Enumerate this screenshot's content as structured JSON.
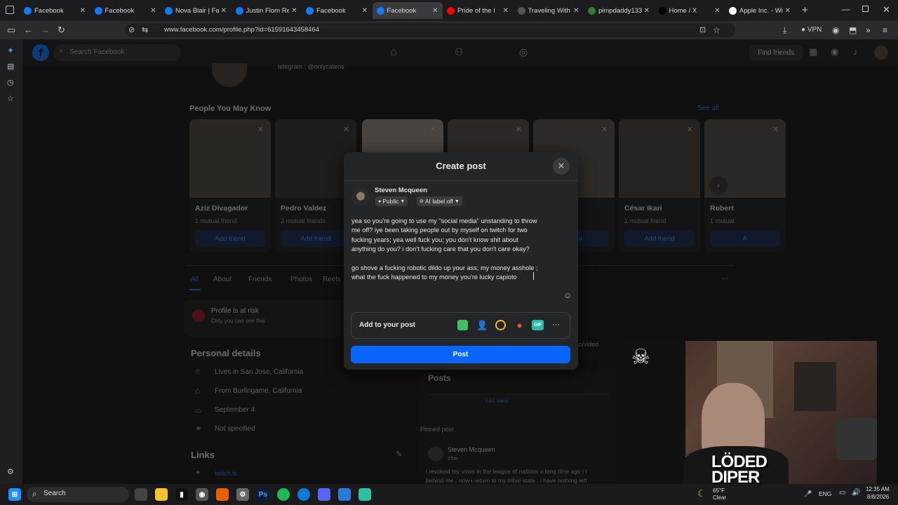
{
  "browser": {
    "tabs": [
      {
        "title": "Facebook",
        "icon": "facebook-icon",
        "color": "#1877f2"
      },
      {
        "title": "Facebook",
        "icon": "facebook-icon",
        "color": "#1877f2"
      },
      {
        "title": "Nova Blair | Faceb",
        "icon": "facebook-icon",
        "color": "#1877f2"
      },
      {
        "title": "Justin Flom Reels",
        "icon": "facebook-icon",
        "color": "#1877f2"
      },
      {
        "title": "Facebook",
        "icon": "facebook-icon",
        "color": "#1877f2"
      },
      {
        "title": "Facebook",
        "icon": "facebook-icon",
        "color": "#1877f2"
      },
      {
        "title": "Pride of the I",
        "icon": "youtube-icon",
        "color": "#ff0000"
      },
      {
        "title": "Traveling With A",
        "icon": "shield-icon",
        "color": "#555555"
      },
      {
        "title": "pimpdaddy1337",
        "icon": "leaf-icon",
        "color": "#2e7d32"
      },
      {
        "title": "Home / X",
        "icon": "x-icon",
        "color": "#000000"
      },
      {
        "title": "Apple Inc. - Wikip",
        "icon": "wikipedia-icon",
        "color": "#ffffff"
      }
    ],
    "url": "www.facebook.com/profile.php?id=61591643458464",
    "vpn_label": "VPN"
  },
  "facebook": {
    "search_placeholder": "Search Facebook",
    "find_friends": "Find friends",
    "profile_handle": "telegram : @onlycateos",
    "pymk_title": "People You May Know",
    "see_all": "See all",
    "suggestions": [
      {
        "name": "Aziz Divagador",
        "mutual": "1 mutual friend",
        "button": "Add friend"
      },
      {
        "name": "Pedro Valdez",
        "mutual": "3 mutual friends",
        "button": "Add friend"
      },
      {
        "name": "",
        "mutual": "",
        "button": ""
      },
      {
        "name": "",
        "mutual": "",
        "button": ""
      },
      {
        "name": "oy",
        "mutual": "nds",
        "button": "friend"
      },
      {
        "name": "César Ikari",
        "mutual": "1 mutual friend",
        "button": "Add friend"
      },
      {
        "name": "Robert",
        "mutual": "1 mutual",
        "button": "A"
      }
    ],
    "profile_tabs": [
      "All",
      "About",
      "Friends",
      "Photos",
      "Reels"
    ],
    "risk_title": "Profile is at risk",
    "risk_sub": "Only you can see this",
    "personal_details_title": "Personal details",
    "details": [
      {
        "icon": "location-icon",
        "text": "Lives in San Jose, California"
      },
      {
        "icon": "home-icon",
        "text": "From Burlingame, California"
      },
      {
        "icon": "cake-icon",
        "text": "September 4"
      },
      {
        "icon": "relationship-icon",
        "text": "Not specified"
      }
    ],
    "links_title": "Links",
    "link_item": "twitch.tv",
    "photo_video": "to/video",
    "posts_title": "Posts",
    "list_view": "List view",
    "pinned_post": "Pinned post",
    "pinned_author": "Steven Mcqueen",
    "pinned_time": "15m",
    "pinned_text_1": "i revoked my vows in the league of nations a long time ago i t",
    "pinned_text_2": "behind me ; now i return to my tribal state ; i have nothing left"
  },
  "modal": {
    "title": "Create post",
    "author": "Steven Mcqueen",
    "audience": "Public",
    "ai_label": "AI label off",
    "lines": [
      "yea so you're going to use my \"social media\" unstanding to throw",
      "me off? iye been taking people out by myself on twitch for two",
      "fucking years; yea well fuck you; you don't know shit about",
      "anything do you? i don't fucking care that you don't care okay?",
      "",
      "go shove a fucking robotic dildo up your ass;  my money asshole ;",
      "what the fuck happened to my money you're lucky capioto"
    ],
    "add_to_post": "Add to your post",
    "post_button": "Post",
    "gif_label": "GIF"
  },
  "taskbar": {
    "search_label": "Search",
    "weather_temp": "65°F",
    "weather_cond": "Clear",
    "lang": "ENG",
    "time": "12:35 AM",
    "date": "8/8/2026"
  },
  "stream": {
    "logo_line1": "LÖDED",
    "logo_line2": "DIPER"
  }
}
